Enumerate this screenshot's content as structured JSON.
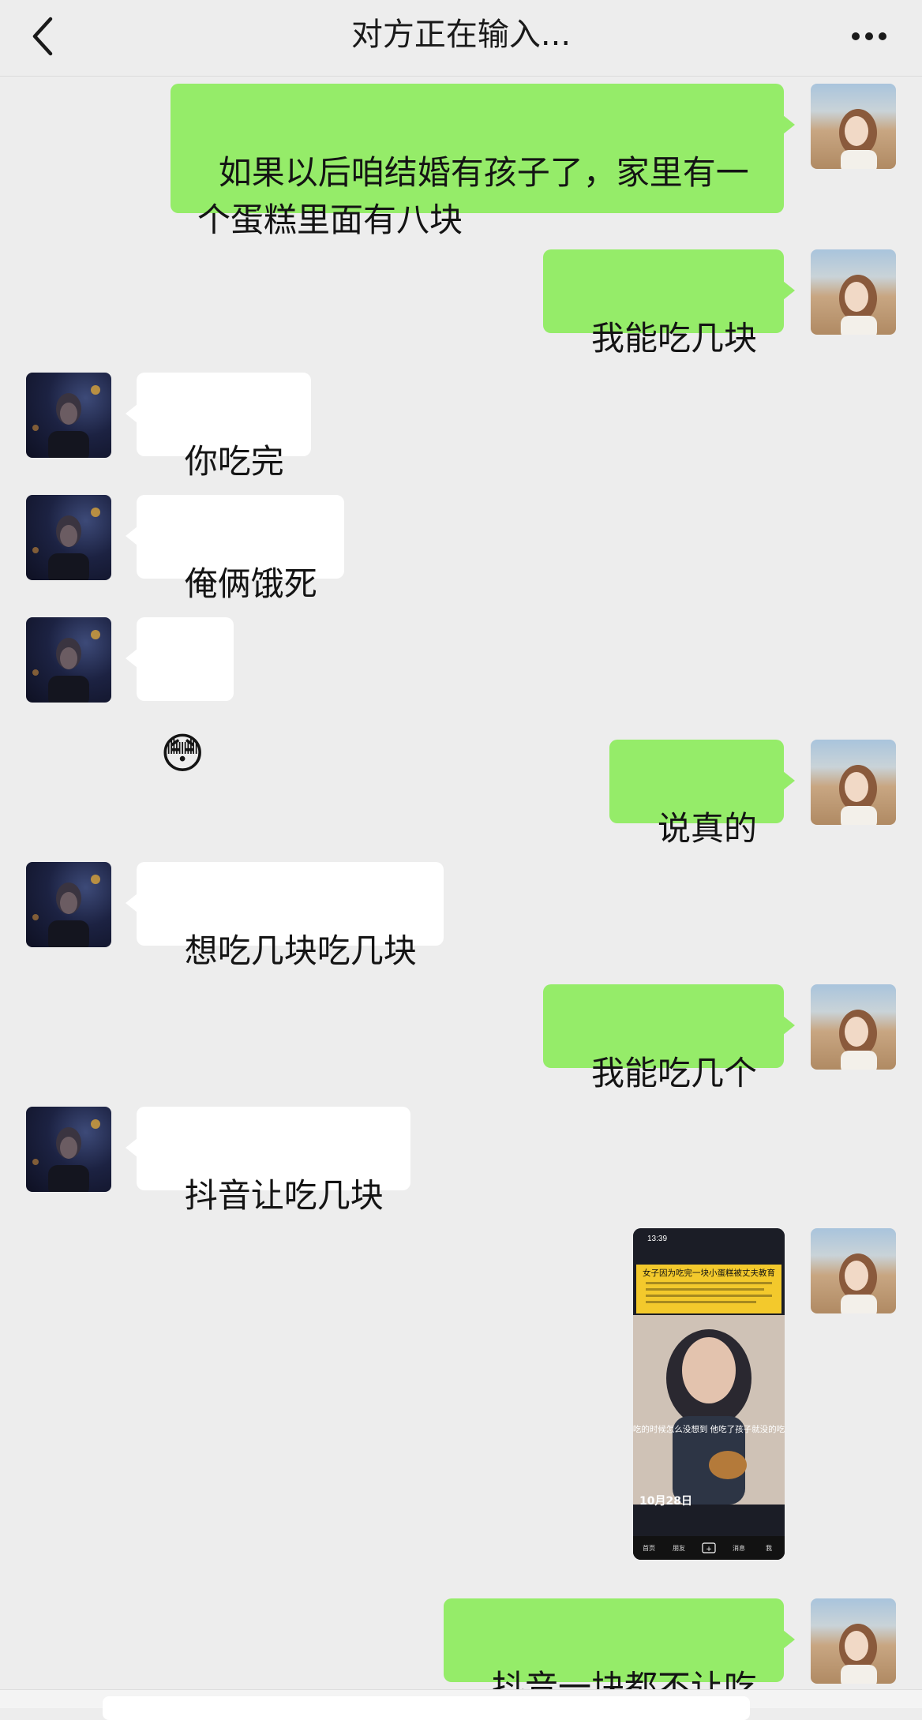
{
  "header": {
    "title": "对方正在输入...",
    "back_icon": "chevron-left-icon",
    "more_icon": "more-dots-icon"
  },
  "video_thumbnail": {
    "status_time": "13:39",
    "headline": "女子因为吃完一块小蛋糕被丈夫教育",
    "caption": "“他吃的时候怎么没想到 他吃了孩子就没的吃呢”",
    "date_stamp": "10月28日",
    "nav": [
      "首页",
      "朋友",
      "+",
      "消息",
      "我"
    ]
  },
  "messages": [
    {
      "sender": "me",
      "text": "如果以后咱结婚有孩子了，家里有一\n个蛋糕里面有八块"
    },
    {
      "sender": "me",
      "text": "我能吃几块"
    },
    {
      "sender": "them",
      "text": "你吃完"
    },
    {
      "sender": "them",
      "text": "俺俩饿死"
    },
    {
      "sender": "them",
      "text": "😳"
    },
    {
      "sender": "me",
      "text": "说真的"
    },
    {
      "sender": "them",
      "text": "想吃几块吃几块"
    },
    {
      "sender": "me",
      "text": "我能吃几个"
    },
    {
      "sender": "them",
      "text": "抖音让吃几块"
    },
    {
      "sender": "me",
      "type": "image"
    },
    {
      "sender": "me",
      "text": "抖音一块都不让吃"
    }
  ],
  "colors": {
    "background": "#ededed",
    "outgoing_bubble": "#95ec69",
    "incoming_bubble": "#ffffff"
  }
}
